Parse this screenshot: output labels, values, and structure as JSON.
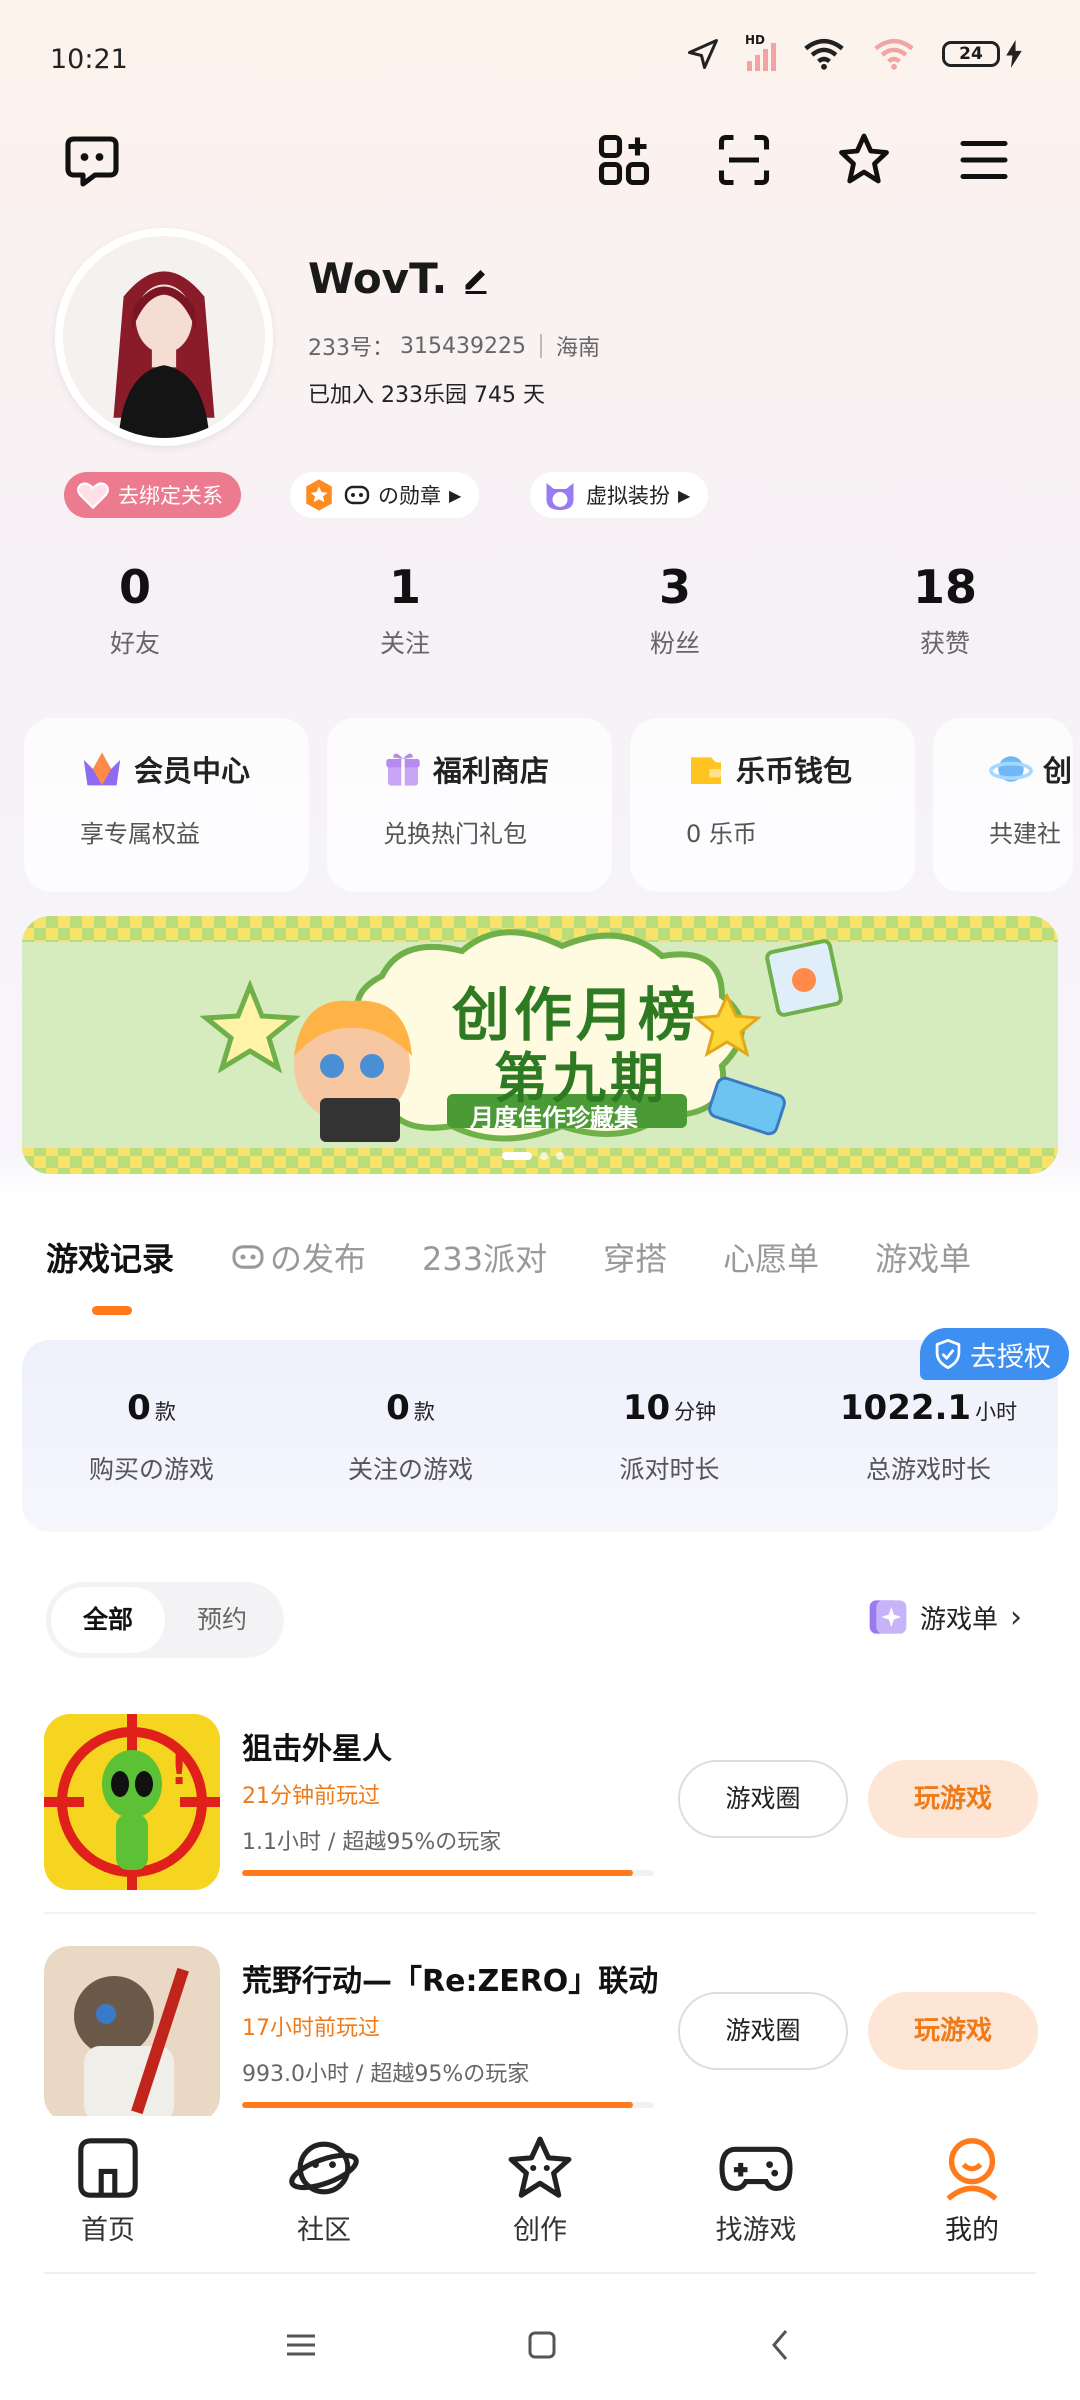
{
  "status": {
    "time": "10:21",
    "battery": "24",
    "hd": "HD"
  },
  "profile": {
    "name": "WovT.",
    "id_label": "233号：",
    "id_value": "315439225",
    "region": "海南",
    "joined": "已加入 233乐园 745 天"
  },
  "chips": {
    "bind": "去绑定关系",
    "badge": "の勋章",
    "outfit": "虚拟装扮"
  },
  "stats": [
    {
      "num": "0",
      "label": "好友"
    },
    {
      "num": "1",
      "label": "关注"
    },
    {
      "num": "3",
      "label": "粉丝"
    },
    {
      "num": "18",
      "label": "获赞"
    }
  ],
  "cards": [
    {
      "title": "会员中心",
      "sub": "享专属权益"
    },
    {
      "title": "福利商店",
      "sub": "兑换热门礼包"
    },
    {
      "title": "乐币钱包",
      "sub": "0  乐币"
    },
    {
      "title": "创",
      "sub": "共建社"
    }
  ],
  "banner": {
    "title1": "创作月榜",
    "title2": "第九期",
    "subtitle": "月度佳作珍藏集"
  },
  "tabs": [
    "游戏记录",
    "の发布",
    "233派对",
    "穿搭",
    "心愿单",
    "游戏单"
  ],
  "auth_badge": "去授权",
  "game_stats": [
    {
      "num": "0",
      "unit": "款",
      "label": "购买の游戏"
    },
    {
      "num": "0",
      "unit": "款",
      "label": "关注の游戏"
    },
    {
      "num": "10",
      "unit": "分钟",
      "label": "派对时长"
    },
    {
      "num": "1022.1",
      "unit": "小时",
      "label": "总游戏时长"
    }
  ],
  "filter": {
    "all": "全部",
    "reserve": "预约"
  },
  "gamelist_link": "游戏单",
  "games": [
    {
      "name": "狙击外星人",
      "recent": "21分钟前玩过",
      "info": "1.1小时  /  超越95%の玩家",
      "progress": 0.95,
      "circle_btn": "游戏圈",
      "play_btn": "玩游戏"
    },
    {
      "name": "荒野行动—「Re:ZERO」联动",
      "recent": "17小时前玩过",
      "info": "993.0小时  /  超越95%の玩家",
      "progress": 0.95,
      "circle_btn": "游戏圈",
      "play_btn": "玩游戏"
    }
  ],
  "bottom_nav": [
    {
      "label": "首页",
      "icon": "home-icon"
    },
    {
      "label": "社区",
      "icon": "community-planet-icon"
    },
    {
      "label": "创作",
      "icon": "create-star-icon"
    },
    {
      "label": "找游戏",
      "icon": "gamepad-icon"
    },
    {
      "label": "我的",
      "icon": "profile-icon"
    }
  ],
  "colors": {
    "accent": "#ff7a1a",
    "play_bg": "#fde6d6",
    "auth": "#3d8ff2",
    "bind": "#ec7b8f"
  }
}
